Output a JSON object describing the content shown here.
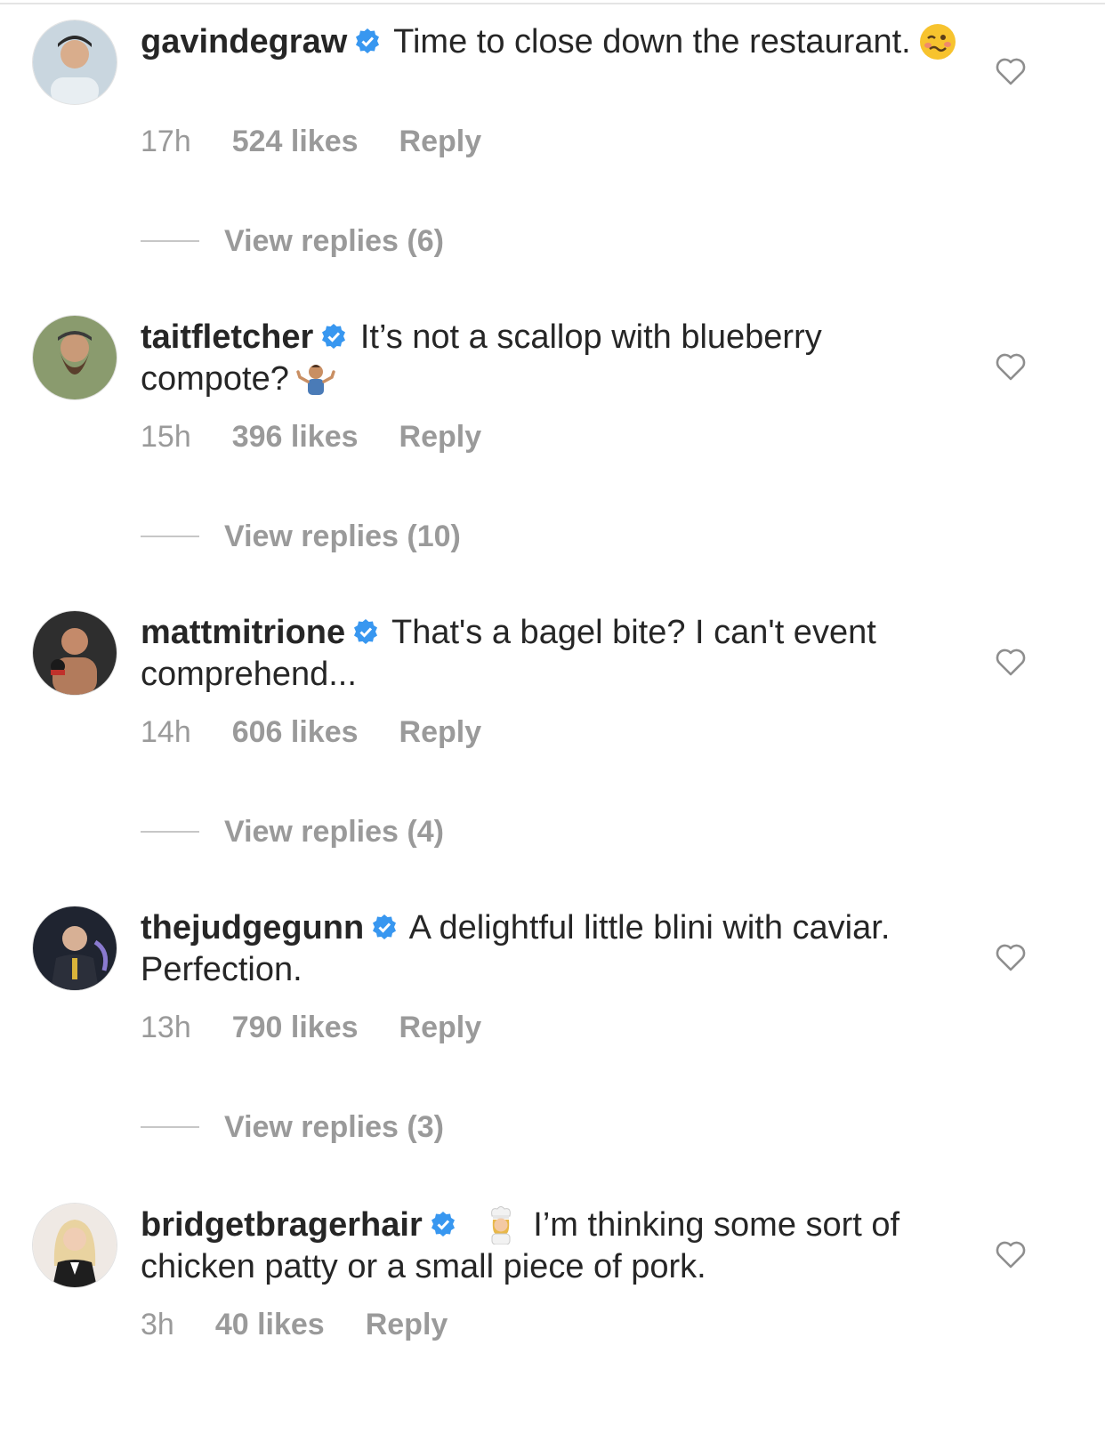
{
  "comments": [
    {
      "username": "gavindegraw",
      "text_before_emoji": "Time to close down the restaurant.",
      "text_after_emoji": "",
      "emoji": "woozy-face",
      "time": "17h",
      "likes": "524 likes",
      "reply": "Reply",
      "view_replies": "View replies (6)"
    },
    {
      "username": "taitfletcher",
      "text_before_emoji": "It’s not a scallop with blueberry compote?",
      "text_after_emoji": "",
      "emoji": "person-shrugging",
      "time": "15h",
      "likes": "396 likes",
      "reply": "Reply",
      "view_replies": "View replies (10)"
    },
    {
      "username": "mattmitrione",
      "text_before_emoji": "That's a bagel bite? I can't event comprehend...",
      "text_after_emoji": "",
      "emoji": "",
      "time": "14h",
      "likes": "606 likes",
      "reply": "Reply",
      "view_replies": "View replies (4)"
    },
    {
      "username": "thejudgegunn",
      "text_before_emoji": "A delightful little blini with caviar. Perfection.",
      "text_after_emoji": "",
      "emoji": "",
      "time": "13h",
      "likes": "790 likes",
      "reply": "Reply",
      "view_replies": "View replies (3)"
    },
    {
      "username": "bridgetbragerhair",
      "text_before_emoji": "",
      "text_after_emoji": "I’m thinking some sort of chicken patty or a small piece of pork.",
      "emoji": "woman-cook",
      "time": "3h",
      "likes": "40 likes",
      "reply": "Reply",
      "view_replies": ""
    }
  ],
  "colors": {
    "username": "#262626",
    "meta": "#9a9a9a",
    "verified": "#3897f0",
    "divider": "#c7c7c7"
  },
  "icons": [
    "verified-badge-icon",
    "heart-outline-icon",
    "avatar"
  ]
}
